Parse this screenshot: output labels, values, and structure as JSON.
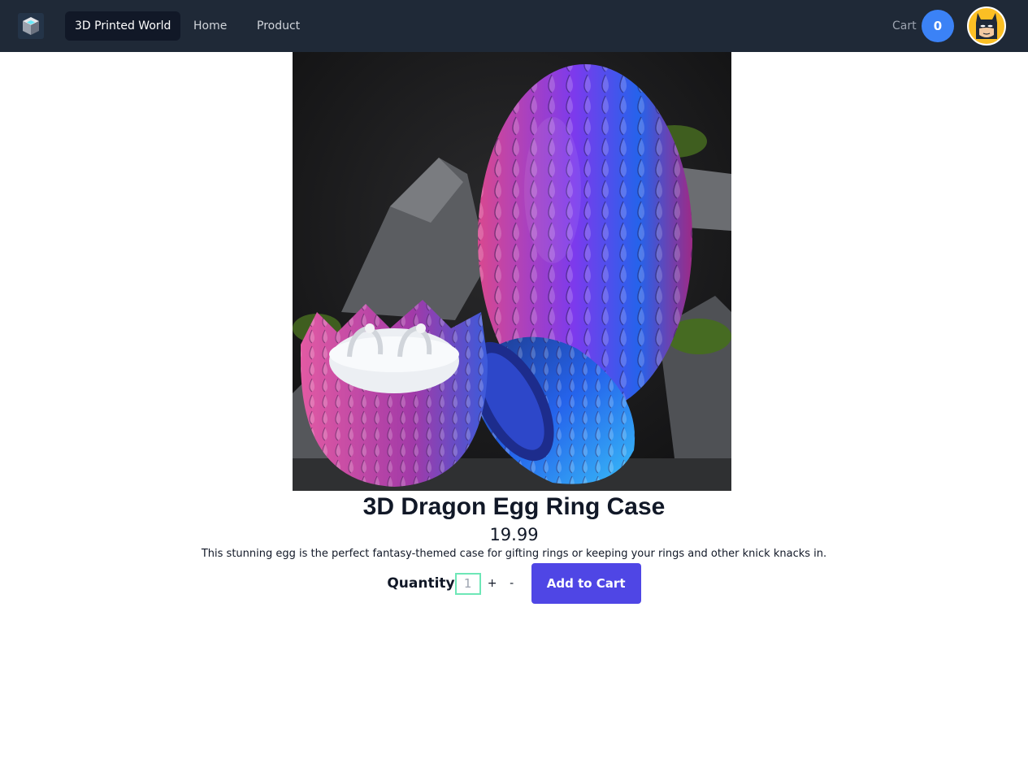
{
  "navbar": {
    "brand_label": "3D Printed World",
    "links": [
      "Home",
      "Product"
    ],
    "cart_label": "Cart",
    "cart_count": "0",
    "background": "#1f2937"
  },
  "product": {
    "title": "3D Dragon Egg Ring Case",
    "price": "19.99",
    "description": "This stunning egg is the perfect fantasy-themed case for gifting rings or keeping your rings and other knick knacks in.",
    "image_subject": "dragon-egg-ring-case-photo"
  },
  "purchase": {
    "quantity_label": "Quantity",
    "quantity_value": "1",
    "increment_label": "+",
    "decrement_label": "-",
    "add_to_cart_label": "Add to Cart",
    "accent": "#4f46e5"
  },
  "icons": {
    "logo": "cube-logo-icon",
    "avatar": "batman-avatar"
  }
}
